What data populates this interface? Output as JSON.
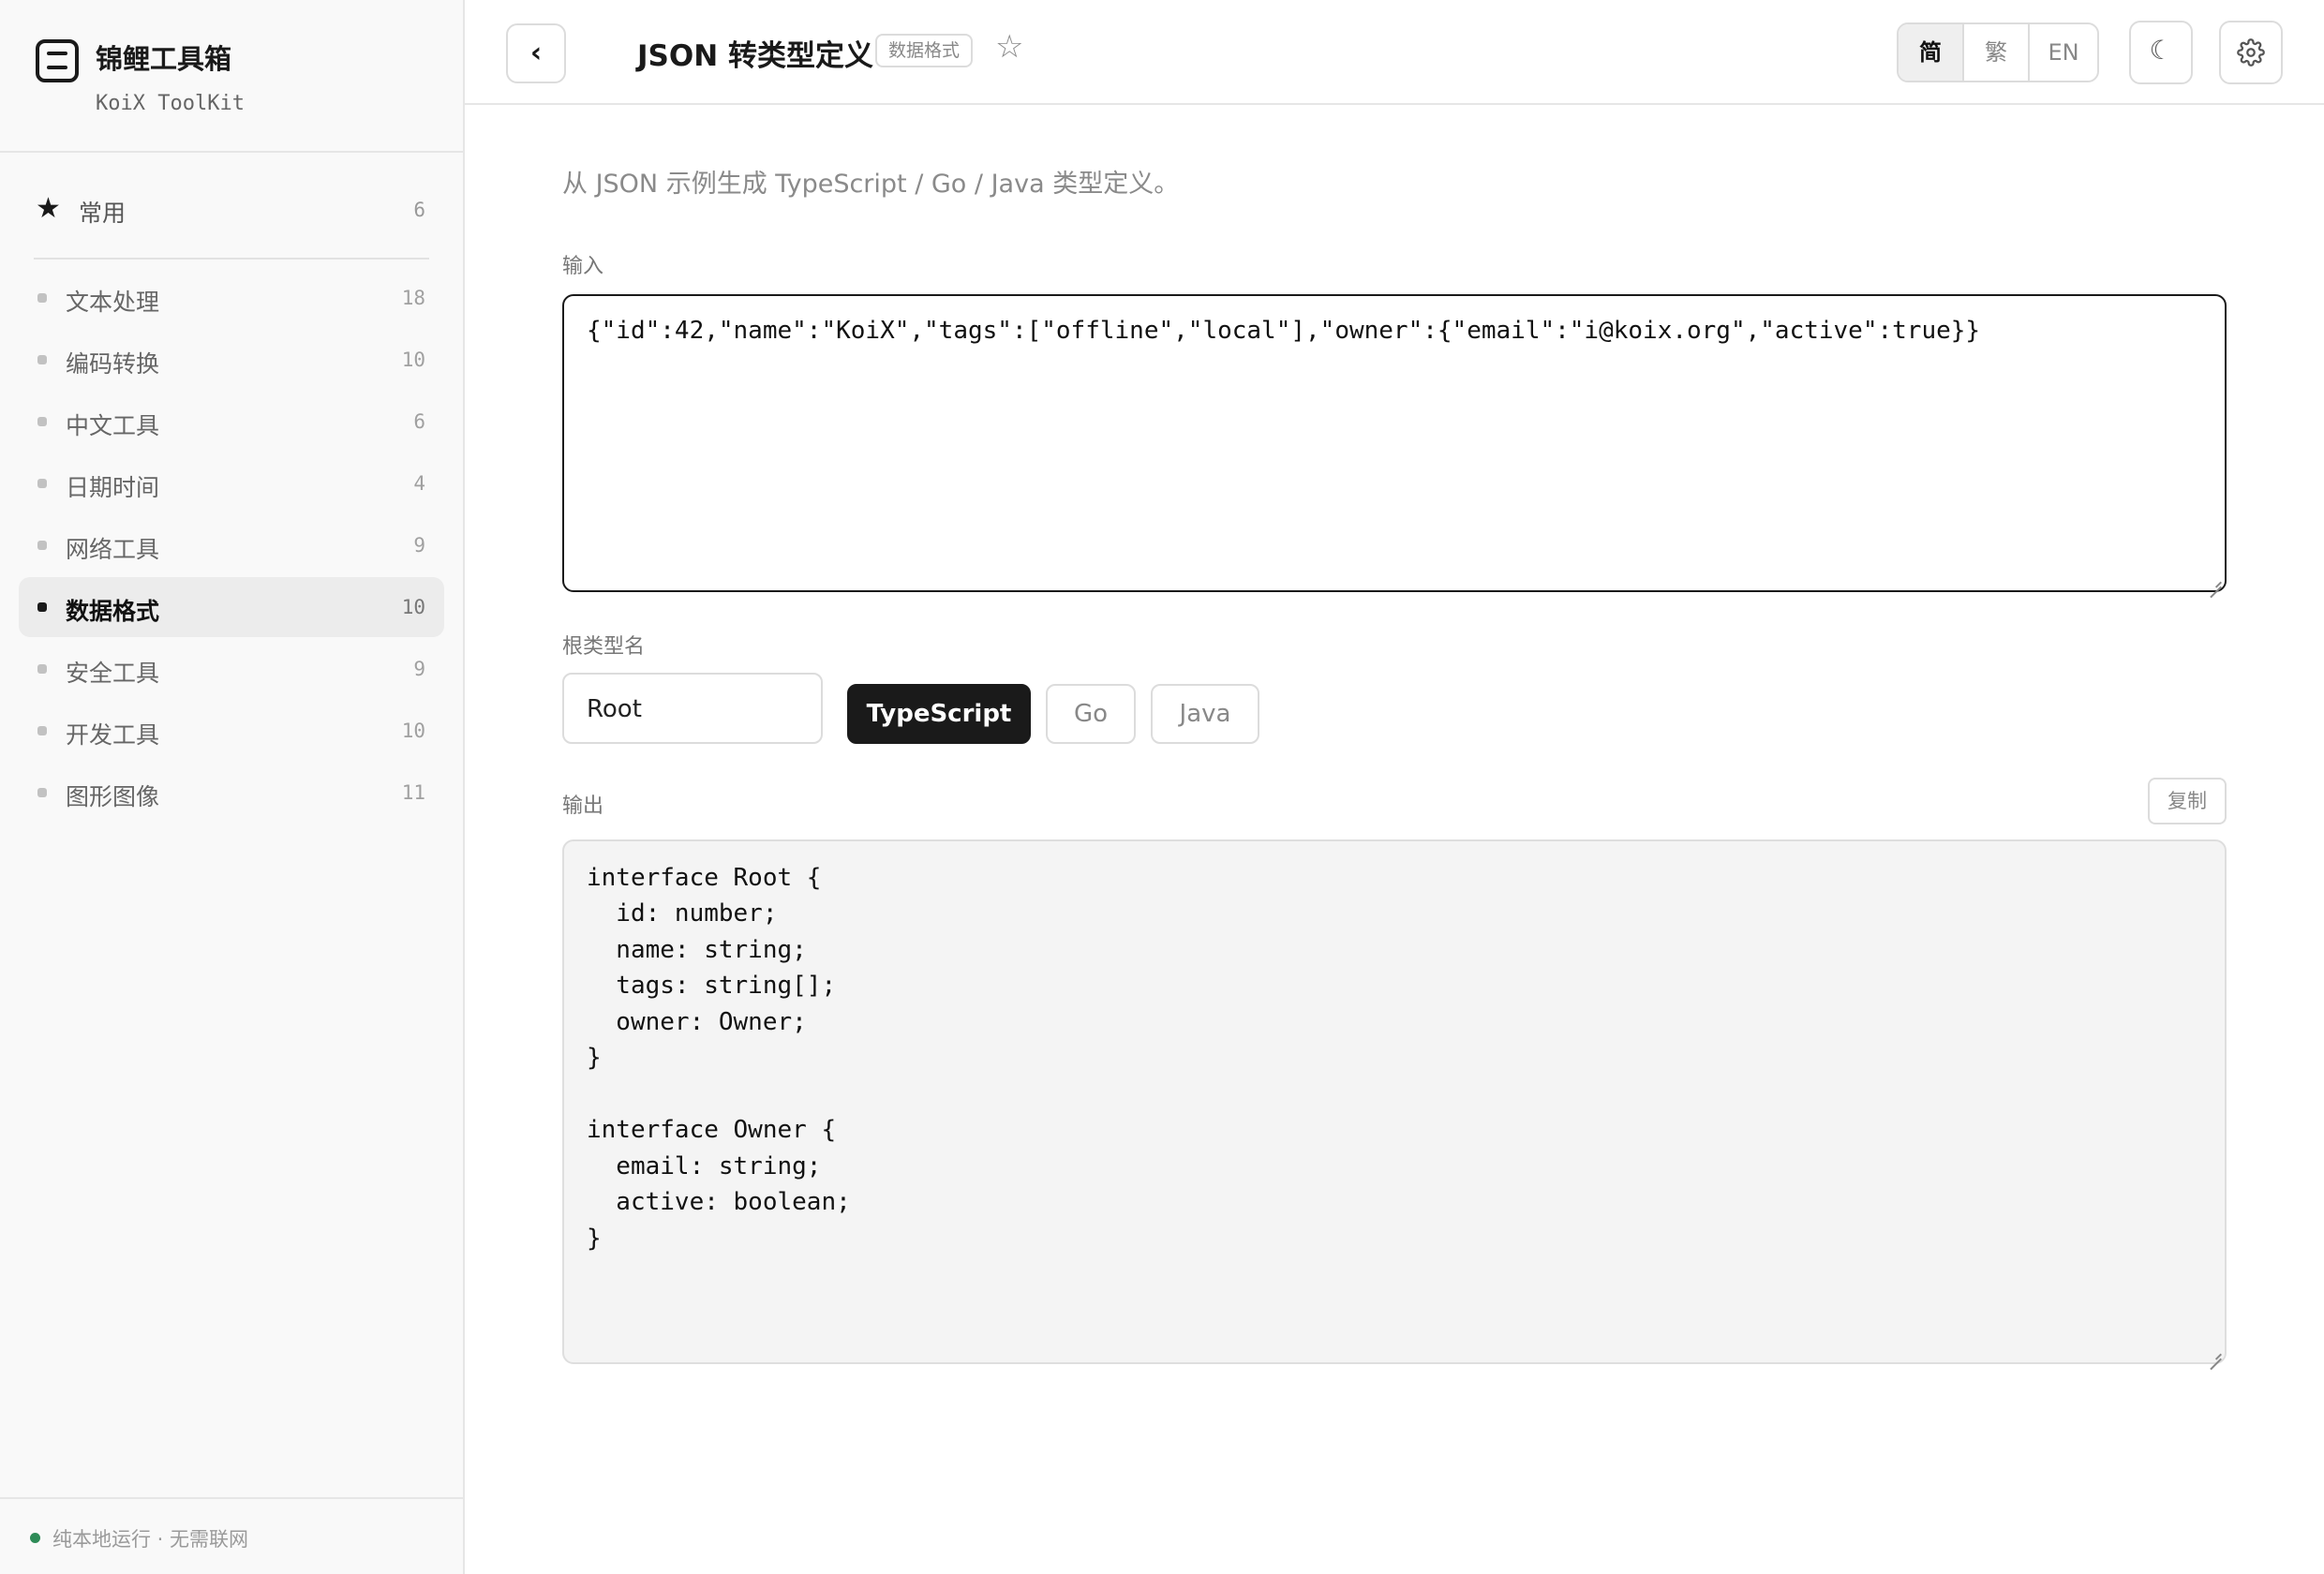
{
  "sidebar": {
    "brand": {
      "title": "锦鲤工具箱",
      "subtitle": "KoiX ToolKit"
    },
    "favorites": {
      "label": "常用",
      "count": "6"
    },
    "items": [
      {
        "label": "文本处理",
        "count": "18"
      },
      {
        "label": "编码转换",
        "count": "10"
      },
      {
        "label": "中文工具",
        "count": "6"
      },
      {
        "label": "日期时间",
        "count": "4"
      },
      {
        "label": "网络工具",
        "count": "9"
      },
      {
        "label": "数据格式",
        "count": "10",
        "active": true
      },
      {
        "label": "安全工具",
        "count": "9"
      },
      {
        "label": "开发工具",
        "count": "10"
      },
      {
        "label": "图形图像",
        "count": "11"
      }
    ],
    "footer": {
      "status": "纯本地运行 · 无需联网",
      "status_color": "#2e8b57"
    }
  },
  "header": {
    "back_icon": "chevron-left-icon",
    "title": "JSON 转类型定义",
    "category_badge": "数据格式",
    "favorite_icon": "star-outline-icon",
    "languages": [
      {
        "label": "简",
        "active": true
      },
      {
        "label": "繁"
      },
      {
        "label": "EN"
      }
    ],
    "theme_icon": "moon-icon",
    "settings_icon": "gear-icon"
  },
  "main": {
    "description": "从 JSON 示例生成 TypeScript / Go / Java 类型定义。",
    "input_label": "输入",
    "input_value": "{\"id\":42,\"name\":\"KoiX\",\"tags\":[\"offline\",\"local\"],\"owner\":{\"email\":\"i@koix.org\",\"active\":true}}",
    "root_label": "根类型名",
    "root_value": "Root",
    "targets": [
      {
        "label": "TypeScript",
        "active": true
      },
      {
        "label": "Go"
      },
      {
        "label": "Java"
      }
    ],
    "output_label": "输出",
    "copy_label": "复制",
    "output_lines": [
      "interface Root {",
      "  id: number;",
      "  name: string;",
      "  tags: string[];",
      "  owner: Owner;",
      "}",
      "",
      "interface Owner {",
      "  email: string;",
      "  active: boolean;",
      "}"
    ]
  },
  "colors": {
    "accent": "#1a1a1a",
    "sidebar_bg": "#f9f9f9",
    "output_bg": "#f4f4f4"
  }
}
